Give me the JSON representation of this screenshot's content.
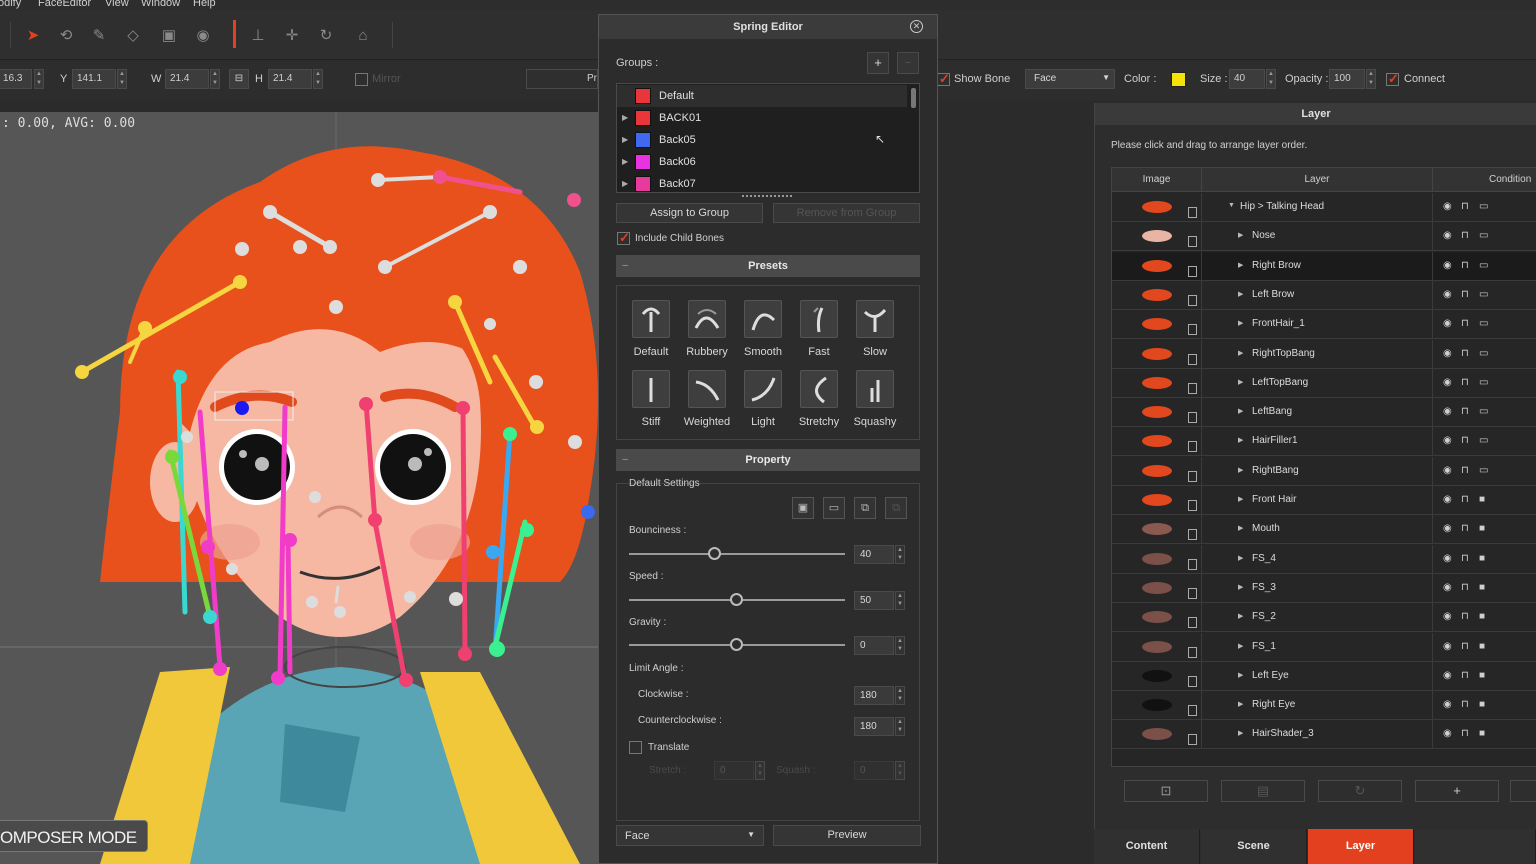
{
  "menu": [
    "odify",
    "FaceEditor",
    "View",
    "Window",
    "Help"
  ],
  "transform": {
    "x_value": "16.3",
    "y_label": "Y",
    "y_value": "141.1",
    "w_label": "W",
    "w_value": "21.4",
    "h_label": "H",
    "h_value": "21.4",
    "mirror_label": "Mirror",
    "pr_button": "Pr"
  },
  "display": {
    "show_bone": "Show Bone",
    "face_select": "Face",
    "color_label": "Color :",
    "color": "#f5e20a",
    "size_label": "Size :",
    "size_value": "40",
    "opacity_label": "Opacity :",
    "opacity_value": "100",
    "connect": "Connect"
  },
  "viewport": {
    "readout": ": 0.00, AVG: 0.00",
    "badge": "OMPOSER MODE"
  },
  "spring_editor": {
    "title": "Spring Editor",
    "groups_label": "Groups :",
    "groups": [
      {
        "name": "Default",
        "color": "#e8363a"
      },
      {
        "name": "BACK01",
        "color": "#e8363a"
      },
      {
        "name": "Back05",
        "color": "#3f6af0"
      },
      {
        "name": "Back06",
        "color": "#e834e0"
      },
      {
        "name": "Back07",
        "color": "#e83a9c"
      }
    ],
    "assign_to_group": "Assign to Group",
    "remove_from_group": "Remove from Group",
    "include_child_bones": "Include Child Bones",
    "presets_title": "Presets",
    "presets": [
      "Default",
      "Rubbery",
      "Smooth",
      "Fast",
      "Slow",
      "Stiff",
      "Weighted",
      "Light",
      "Stretchy",
      "Squashy"
    ],
    "property_title": "Property",
    "default_settings": "Default Settings",
    "bounciness_label": "Bounciness :",
    "bounciness": 40,
    "speed_label": "Speed :",
    "speed": 50,
    "gravity_label": "Gravity :",
    "gravity": 0,
    "limit_angle_label": "Limit Angle :",
    "clockwise_label": "Clockwise :",
    "clockwise": "180",
    "counterclockwise_label": "Counterclockwise :",
    "counterclockwise": "180",
    "translate_label": "Translate",
    "stretch_label": "Stretch :",
    "stretch_value": "0",
    "squash_label": "Squash :",
    "squash_value": "0",
    "bottom_select": "Face",
    "preview_button": "Preview"
  },
  "layer_panel": {
    "title": "Layer",
    "hint": "Please click and drag to arrange layer order.",
    "col_image": "Image",
    "col_layer": "Layer",
    "col_condition": "Condition",
    "rows": [
      {
        "name": "Hip > Talking Head",
        "expanded": true,
        "thumb": "#e2481e"
      },
      {
        "name": "Nose",
        "thumb": "#e8b4a4"
      },
      {
        "name": "Right Brow",
        "thumb": "#e2481e",
        "selected": true
      },
      {
        "name": "Left Brow",
        "thumb": "#e2481e"
      },
      {
        "name": "FrontHair_1",
        "thumb": "#e2481e"
      },
      {
        "name": "RightTopBang",
        "thumb": "#e2481e"
      },
      {
        "name": "LeftTopBang",
        "thumb": "#e2481e"
      },
      {
        "name": "LeftBang",
        "thumb": "#e2481e"
      },
      {
        "name": "HairFiller1",
        "thumb": "#e2481e"
      },
      {
        "name": "RightBang",
        "thumb": "#e2481e"
      },
      {
        "name": "Front Hair",
        "thumb": "#e2481e"
      },
      {
        "name": "Mouth",
        "thumb": "#8a5a50"
      },
      {
        "name": "FS_4",
        "thumb": "#7a5048"
      },
      {
        "name": "FS_3",
        "thumb": "#7a5048"
      },
      {
        "name": "FS_2",
        "thumb": "#7a5048"
      },
      {
        "name": "FS_1",
        "thumb": "#7a5048"
      },
      {
        "name": "Left Eye",
        "thumb": "#111111"
      },
      {
        "name": "Right Eye",
        "thumb": "#111111"
      },
      {
        "name": "HairShader_3",
        "thumb": "#7a5048"
      }
    ],
    "add_button": "+"
  },
  "bottom_tabs": [
    "Content",
    "Scene",
    "Layer"
  ]
}
